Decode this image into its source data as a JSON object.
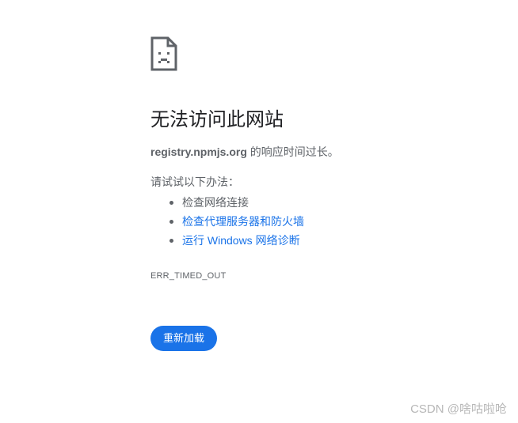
{
  "error_page": {
    "icon": "sad-page-icon",
    "title": "无法访问此网站",
    "host": "registry.npmjs.org",
    "description_suffix": " 的响应时间过长。",
    "try_label": "请试试以下办法：",
    "suggestions": [
      {
        "text": "检查网络连接",
        "is_link": false
      },
      {
        "text": "检查代理服务器和防火墙",
        "is_link": true
      },
      {
        "text": "运行 Windows 网络诊断",
        "is_link": true
      }
    ],
    "error_code": "ERR_TIMED_OUT",
    "reload_label": "重新加载"
  },
  "watermark": "CSDN @啥咕啦呛",
  "colors": {
    "accent": "#1a73e8",
    "text_primary": "#202124",
    "text_secondary": "#5f6368",
    "watermark": "#b7b7b7"
  }
}
